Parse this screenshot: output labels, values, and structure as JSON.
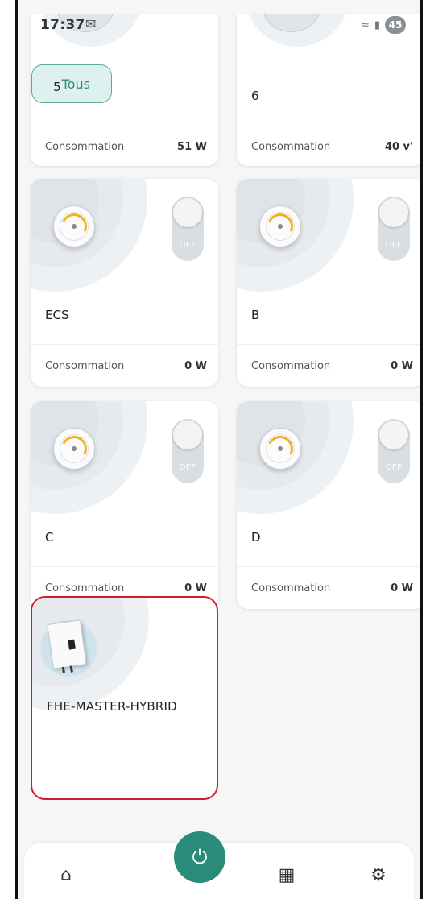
{
  "status_bar": {
    "time": "17:37",
    "battery": "45"
  },
  "filter": {
    "number": "5",
    "label": "Tous"
  },
  "top_cards": [
    {
      "name": "",
      "consumption_label": "Consommation",
      "consumption_value": "51 W"
    },
    {
      "name": "6",
      "consumption_label": "Consommation",
      "consumption_value": "40 v'"
    }
  ],
  "cards": [
    {
      "name": "ECS",
      "toggle": "OFF",
      "consumption_label": "Consommation",
      "consumption_value": "0 W"
    },
    {
      "name": "B",
      "toggle": "OFF",
      "consumption_label": "Consommation",
      "consumption_value": "0 W"
    },
    {
      "name": "C",
      "toggle": "OFF",
      "consumption_label": "Consommation",
      "consumption_value": "0 W"
    },
    {
      "name": "D",
      "toggle": "OFF",
      "consumption_label": "Consommation",
      "consumption_value": "0 W"
    }
  ],
  "inverter_card": {
    "name": "FHE-MASTER-HYBRID",
    "highlight_color": "#cc1f2c"
  },
  "bottom_nav": {
    "items": [
      {
        "icon": "home-icon"
      },
      {
        "icon": "power-icon",
        "active": true
      },
      {
        "icon": "solar-panel-icon"
      },
      {
        "icon": "gear-icon"
      }
    ]
  },
  "colors": {
    "accent": "#2a8c78",
    "toggle_off": "#d9dee3",
    "highlight": "#cc1f2c"
  }
}
